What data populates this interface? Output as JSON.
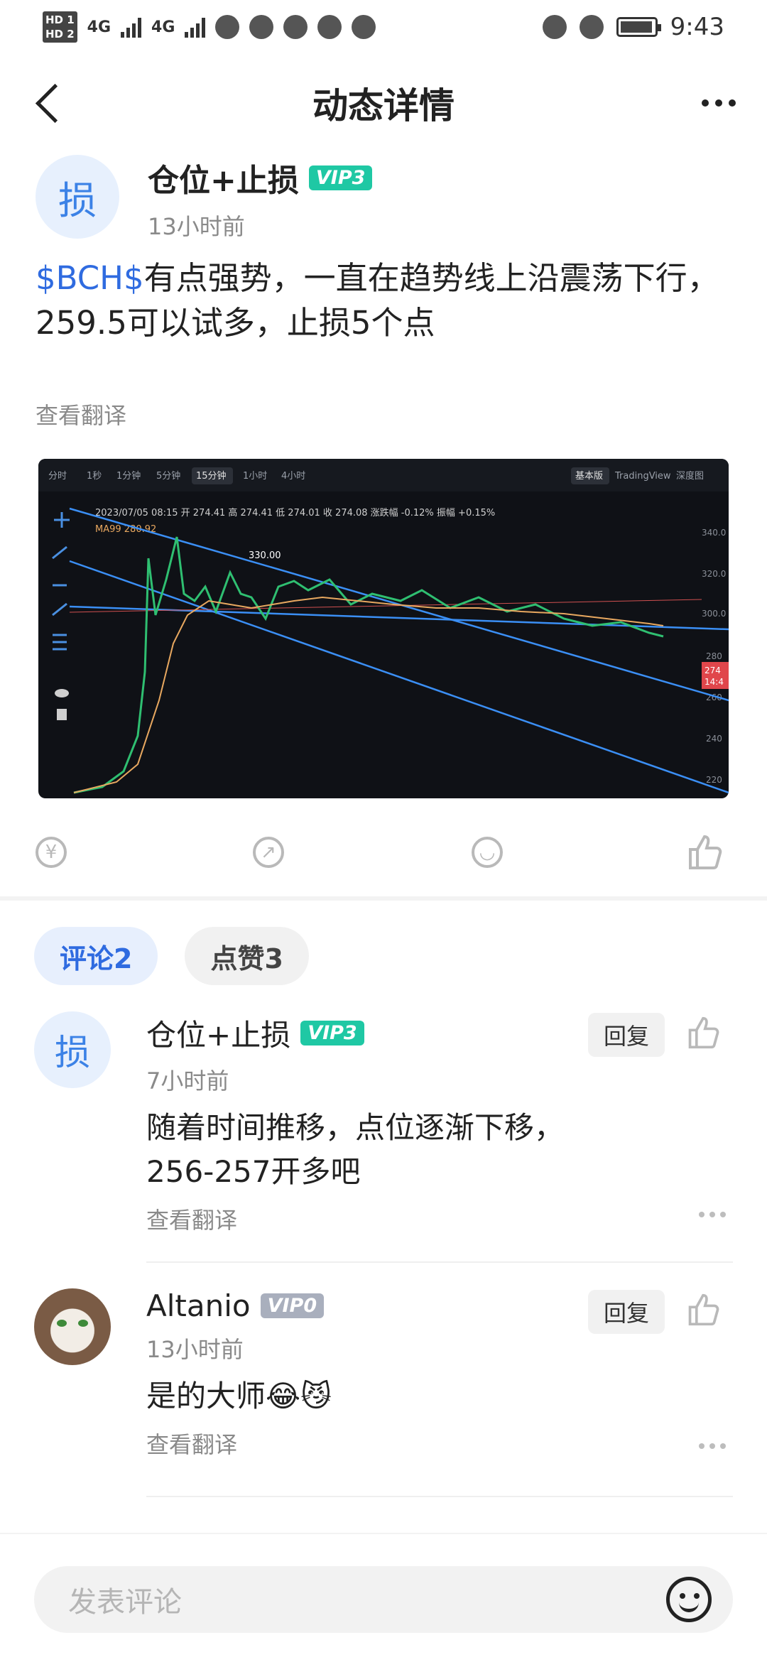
{
  "status_bar": {
    "left_badges": [
      "HD 1",
      "HD 2",
      "4G",
      "4G"
    ],
    "time": "9:43"
  },
  "header": {
    "title": "动态详情"
  },
  "post": {
    "author_initial": "损",
    "author_name": "仓位+止损",
    "vip": "VIP3",
    "time": "13小时前",
    "text_tag": "$BCH$",
    "text_line1": "有点强势，一直在趋势线上沿震荡下行，",
    "text_line2": "259.5可以试多，止损5个点",
    "translate": "查看翻译"
  },
  "chart_image": {
    "toolbar": [
      "分时",
      "1秒",
      "1分钟",
      "5分钟",
      "15分钟",
      "1小时",
      "4小时"
    ],
    "toolbar_right": [
      "基本版",
      "TradingView",
      "深度图"
    ],
    "ohlc_line": "2023/07/05 08:15  开 274.41  高 274.41  低 274.01  收 274.08  涨跌幅 -0.12%  振幅 +0.15%",
    "ma_line": "MA99  280.92",
    "peak_label": "330.00",
    "price_ticks": [
      "340.0",
      "320.0",
      "300.0",
      "280",
      "260",
      "240",
      "220"
    ],
    "current_price": "274",
    "current_time": "14:4"
  },
  "actions": [
    "reward",
    "share",
    "comment",
    "like"
  ],
  "tabs": [
    {
      "label": "评论2",
      "active": true
    },
    {
      "label": "点赞3",
      "active": false
    }
  ],
  "comments": [
    {
      "initial": "损",
      "name": "仓位+止损",
      "vip": "VIP3",
      "time": "7小时前",
      "line1": "随着时间推移，点位逐渐下移，",
      "line2": "256-257开多吧",
      "translate": "查看翻译",
      "reply": "回复"
    },
    {
      "name": "Altanio",
      "vip": "VIP0",
      "time": "13小时前",
      "line1": "是的大师😂😼",
      "translate": "查看翻译",
      "reply": "回复"
    }
  ],
  "composer": {
    "placeholder": "发表评论"
  }
}
